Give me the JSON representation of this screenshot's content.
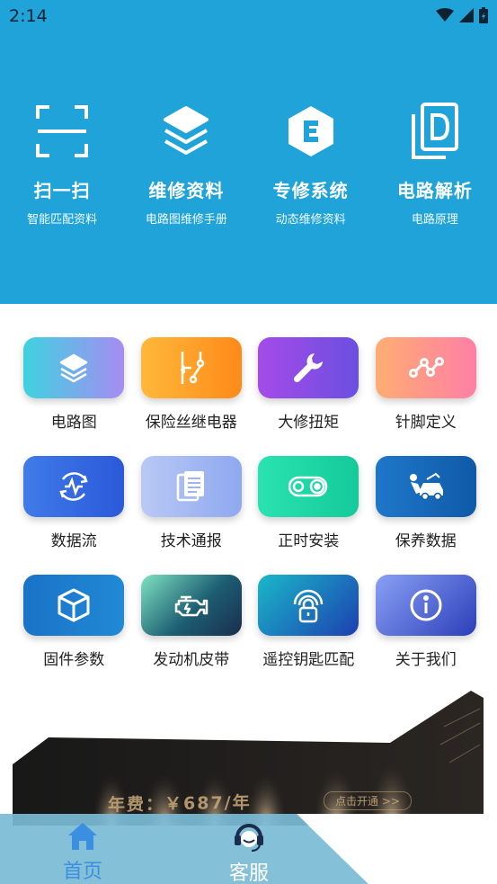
{
  "status_bar": {
    "time": "2:14"
  },
  "quick_actions": [
    {
      "title": "扫一扫",
      "subtitle": "智能匹配资料",
      "icon": "scan-icon"
    },
    {
      "title": "维修资料",
      "subtitle": "电路图维修手册",
      "icon": "layers-icon"
    },
    {
      "title": "专修系统",
      "subtitle": "动态维修资料",
      "icon": "hexagon-e-icon"
    },
    {
      "title": "电路解析",
      "subtitle": "电路原理",
      "icon": "document-d-icon"
    }
  ],
  "grid": [
    {
      "label": "电路图",
      "icon": "layers-icon"
    },
    {
      "label": "保险丝继电器",
      "icon": "relay-icon"
    },
    {
      "label": "大修扭矩",
      "icon": "wrench-icon"
    },
    {
      "label": "针脚定义",
      "icon": "pin-graph-icon"
    },
    {
      "label": "数据流",
      "icon": "data-flow-icon"
    },
    {
      "label": "技术通报",
      "icon": "document-icon"
    },
    {
      "label": "正时安装",
      "icon": "timing-belt-icon"
    },
    {
      "label": "保养数据",
      "icon": "car-service-icon"
    },
    {
      "label": "固件参数",
      "icon": "cube-icon"
    },
    {
      "label": "发动机皮带",
      "icon": "engine-icon"
    },
    {
      "label": "遥控钥匙匹配",
      "icon": "remote-key-icon"
    },
    {
      "label": "关于我们",
      "icon": "info-icon"
    }
  ],
  "banner": {
    "price_text": "年费：￥687/年",
    "cta": "点击开通 >>"
  },
  "bottom_nav": {
    "home": "首页",
    "service": "客服"
  },
  "colors": {
    "header": "#1fa3d8",
    "active_nav": "#3a8fe0"
  }
}
